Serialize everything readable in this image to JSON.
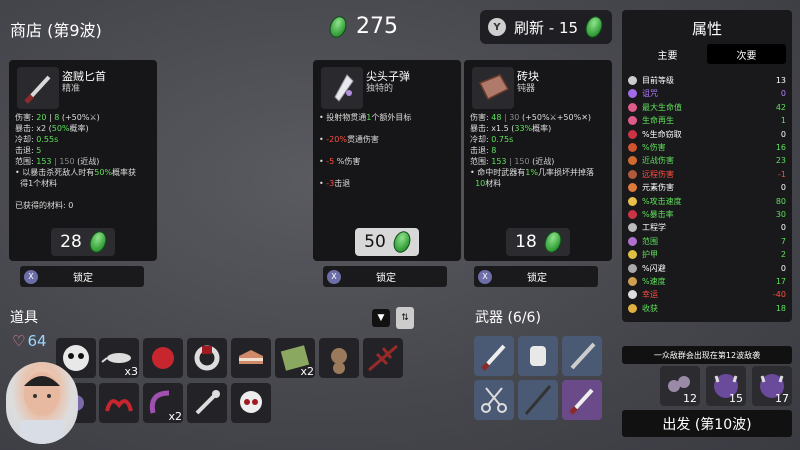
{
  "header": {
    "shop_title": "商店 (第9波)",
    "materials": "275",
    "reroll_label": "刷新 - 15",
    "reroll_key": "Y"
  },
  "cards": [
    {
      "name": "盗贼匕首",
      "tier": "精准",
      "stats": [
        [
          "伤害: ",
          {
            "g": "20"
          },
          " | ",
          {
            "g": "8"
          },
          " (+50%⚔)"
        ],
        [
          "暴击: x2 (",
          {
            "g": "50%"
          },
          "概率)"
        ],
        [
          "冷却: ",
          {
            "g": "0.55s"
          }
        ],
        [
          "击退: ",
          {
            "g": "5"
          }
        ],
        [
          "范围: ",
          {
            "g": "153"
          },
          {
            "dim": " | 150"
          },
          " (近战)"
        ],
        [
          "• 以暴击杀死敌人时有",
          {
            "g": "50%"
          },
          "概率获"
        ],
        [
          "  得1个材料"
        ],
        [
          ""
        ],
        [
          "已获得的材料: 0"
        ]
      ],
      "price": "28",
      "lock": "锁定"
    },
    {
      "name": "尖头子弹",
      "tier": "独特的",
      "stats": [
        [
          "• 投射物贯通",
          {
            "g": "1"
          },
          "个额外目标"
        ],
        [
          ""
        ],
        [
          "• ",
          {
            "r": "-20%"
          },
          "贯通伤害"
        ],
        [
          ""
        ],
        [
          "• ",
          {
            "r": "-5"
          },
          " %伤害"
        ],
        [
          ""
        ],
        [
          "• ",
          {
            "r": "-3"
          },
          "击退"
        ]
      ],
      "price": "50",
      "lock": "锁定"
    },
    {
      "name": "砖块",
      "tier": "钝器",
      "stats": [
        [
          "伤害: ",
          {
            "g": "48"
          },
          {
            "dim": " | 30"
          },
          " (+50%⚔+50%✕)"
        ],
        [
          "暴击: x1.5 (",
          {
            "g": "33%"
          },
          "概率)"
        ],
        [
          "冷却: ",
          {
            "g": "0.75s"
          }
        ],
        [
          "击退: ",
          {
            "g": "8"
          }
        ],
        [
          "范围: ",
          {
            "g": "153"
          },
          {
            "dim": " | 150"
          },
          " (近战)"
        ],
        [
          "• 命中时武器有",
          {
            "g": "1%"
          },
          "几率损坏并掉落"
        ],
        [
          "  ",
          {
            "g": "10"
          },
          "材料"
        ]
      ],
      "price": "18",
      "lock": "锁定"
    }
  ],
  "items_title": "道具",
  "weapons_title": "武器 (6/6)",
  "player_hp": "64",
  "item_counts": {
    "x3": "x3",
    "x2a": "x2",
    "x2b": "x2"
  },
  "panel": {
    "title": "属性",
    "tab_main": "主要",
    "tab_secondary": "次要",
    "stats": [
      {
        "label": "目前等级",
        "value": "13",
        "color": "#ffffff",
        "icon": "#cccccc"
      },
      {
        "label": "诅咒",
        "value": "0",
        "color": "#b57cff",
        "icon": "#a06ae8"
      },
      {
        "label": "最大生命值",
        "value": "42",
        "color": "#5fe05a",
        "icon": "#e05a8a"
      },
      {
        "label": "生命再生",
        "value": "1",
        "color": "#5fe05a",
        "icon": "#e05a8a"
      },
      {
        "label": "%生命窃取",
        "value": "0",
        "color": "#ffffff",
        "icon": "#cc3344"
      },
      {
        "label": "%伤害",
        "value": "16",
        "color": "#5fe05a",
        "icon": "#d0542e"
      },
      {
        "label": "近战伤害",
        "value": "23",
        "color": "#5fe05a",
        "icon": "#d06a2e"
      },
      {
        "label": "远程伤害",
        "value": "-1",
        "color": "#ff4d3d",
        "icon": "#b05a3a"
      },
      {
        "label": "元素伤害",
        "value": "0",
        "color": "#ffffff",
        "icon": "#e07a3a"
      },
      {
        "label": "%攻击速度",
        "value": "80",
        "color": "#5fe05a",
        "icon": "#e8c04a"
      },
      {
        "label": "%暴击率",
        "value": "30",
        "color": "#5fe05a",
        "icon": "#cc3344"
      },
      {
        "label": "工程学",
        "value": "0",
        "color": "#ffffff",
        "icon": "#bbbbbb"
      },
      {
        "label": "范围",
        "value": "7",
        "color": "#5fe05a",
        "icon": "#b070d0"
      },
      {
        "label": "护甲",
        "value": "2",
        "color": "#5fe05a",
        "icon": "#e0c040"
      },
      {
        "label": "%闪避",
        "value": "0",
        "color": "#ffffff",
        "icon": "#aaaaaa"
      },
      {
        "label": "%速度",
        "value": "17",
        "color": "#5fe05a",
        "icon": "#d0a050"
      },
      {
        "label": "幸运",
        "value": "-40",
        "color": "#ff4d3d",
        "icon": "#dddddd"
      },
      {
        "label": "收获",
        "value": "18",
        "color": "#5fe05a",
        "icon": "#e0b040"
      }
    ]
  },
  "horde_notice": "一众敌群会出现在第12波敌袭",
  "enemies": [
    "12",
    "15",
    "17"
  ],
  "go_label": "出发 (第10波)"
}
